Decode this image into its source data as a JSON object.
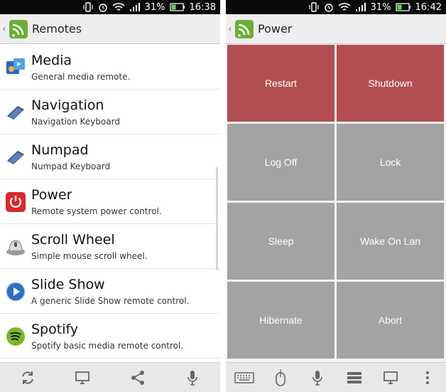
{
  "colors": {
    "status_bar": "#0a0a0a",
    "action_bar": "#eeeeee",
    "tile_red": "#b24d51",
    "tile_gray": "#a3a3a3",
    "bottom_bar": "#e8e8e8"
  },
  "left": {
    "status": {
      "battery": "31%",
      "time": "16:38"
    },
    "actionbar": {
      "title": "Remotes",
      "icon": "remote-app-logo-icon"
    },
    "items": [
      {
        "title": "Media",
        "subtitle": "General media remote.",
        "icon": "media-icon"
      },
      {
        "title": "Navigation",
        "subtitle": "Navigation Keyboard",
        "icon": "keyboard-icon"
      },
      {
        "title": "Numpad",
        "subtitle": "Numpad Keyboard",
        "icon": "keyboard-icon"
      },
      {
        "title": "Power",
        "subtitle": "Remote system power control.",
        "icon": "power-icon"
      },
      {
        "title": "Scroll Wheel",
        "subtitle": "Simple mouse scroll wheel.",
        "icon": "mouse-scroll-icon"
      },
      {
        "title": "Slide Show",
        "subtitle": "A generic Slide Show remote control.",
        "icon": "slideshow-play-icon"
      },
      {
        "title": "Spotify",
        "subtitle": "Spotify basic media remote control.",
        "icon": "spotify-icon"
      }
    ],
    "bottom_icons": [
      "refresh-icon",
      "monitor-icon",
      "share-icon",
      "microphone-icon"
    ]
  },
  "right": {
    "status": {
      "battery": "31%",
      "time": "16:42"
    },
    "actionbar": {
      "title": "Power",
      "icon": "remote-app-logo-icon"
    },
    "tiles": [
      {
        "label": "Restart",
        "color": "red"
      },
      {
        "label": "Shutdown",
        "color": "red"
      },
      {
        "label": "Log Off",
        "color": "gray"
      },
      {
        "label": "Lock",
        "color": "gray"
      },
      {
        "label": "Sleep",
        "color": "gray"
      },
      {
        "label": "Wake On Lan",
        "color": "gray"
      },
      {
        "label": "Hibernate",
        "color": "gray"
      },
      {
        "label": "Abort",
        "color": "gray"
      }
    ],
    "bottom_icons": [
      "keyboard-icon",
      "mouse-icon",
      "microphone-icon",
      "list-icon",
      "monitor-icon",
      "overflow-menu-icon"
    ]
  }
}
